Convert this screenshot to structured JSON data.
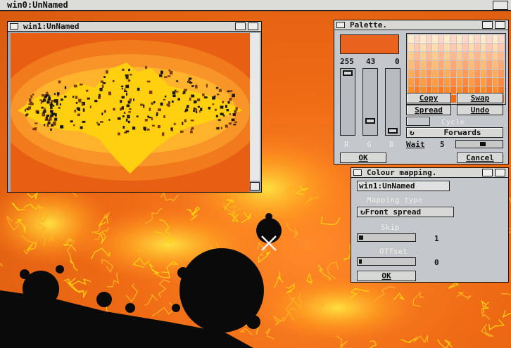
{
  "screen": {
    "title": "win0:UnNamed"
  },
  "win1": {
    "title": "win1:UnNamed"
  },
  "palette": {
    "title": "Palette.",
    "selected_color": "#e8641c",
    "r_value": "255",
    "g_value": "43",
    "b_value": "0",
    "r_level": 1.0,
    "g_level": 0.17,
    "b_level": 0.0,
    "r_letter": "R",
    "g_letter": "G",
    "b_letter": "B",
    "copy_label": "Copy",
    "swap_label": "Swap",
    "spread_label": "Spread",
    "undo_label": "Undo",
    "cycle_label": "Cycle",
    "direction_label": "Forwards",
    "wait_label": "Wait",
    "wait_value": "5",
    "ok_label": "OK",
    "cancel_label": "Cancel"
  },
  "colour_mapping": {
    "title": "Colour mapping.",
    "window_field": "win1:UnNamed",
    "mapping_type_label": "Mapping type",
    "mapping_type_value": "Front spread",
    "skip_label": "Skip",
    "skip_value": "1",
    "offset_label": "Offset",
    "offset_value": "0",
    "ok_label": "OK"
  },
  "colors": {
    "background_orange": "#e86a18",
    "window_grey": "#c4c8cc",
    "fractal_yellow": "#ffd810",
    "set_black": "#0a0a0a"
  }
}
